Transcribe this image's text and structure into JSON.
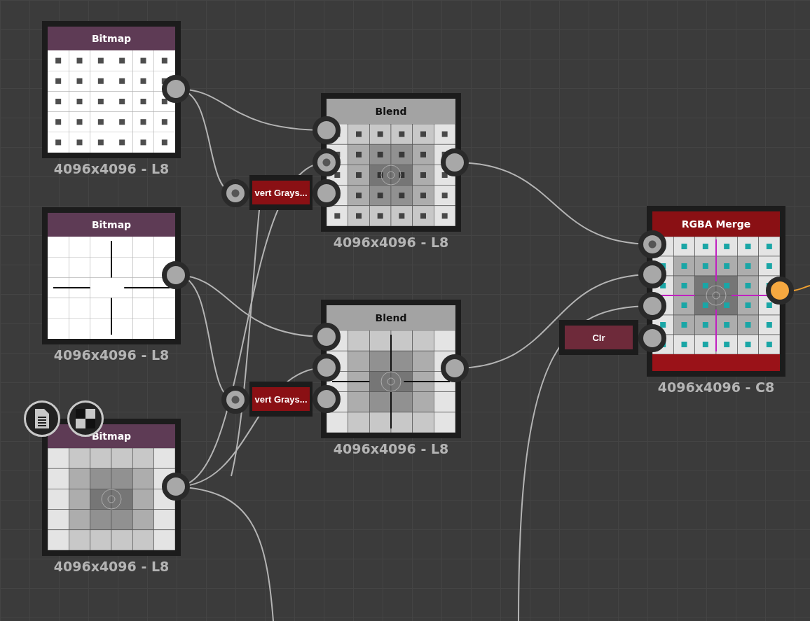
{
  "graph": {
    "nodes": [
      {
        "kind": "bitmap",
        "title": "Bitmap",
        "preview": {
          "kind": "numbered"
        },
        "resolution": "4096x4096 - L8",
        "output": {
          "highlighted": false
        }
      },
      {
        "kind": "bitmap",
        "title": "Bitmap",
        "preview": {
          "kind": "arrows"
        },
        "resolution": "4096x4096 - L8",
        "output": {
          "highlighted": false
        }
      },
      {
        "kind": "bitmap",
        "title": "Bitmap",
        "preview": {
          "kind": "gray"
        },
        "resolution": "4096x4096 - L8",
        "show_badges": true,
        "output": {
          "highlighted": false
        }
      },
      {
        "kind": "invert",
        "title": "vert Grays...",
        "inputs": [
          {
            "active": true
          }
        ]
      },
      {
        "kind": "invert",
        "title": "vert Grays...",
        "inputs": [
          {
            "active": true
          }
        ]
      },
      {
        "kind": "blend",
        "title": "Blend",
        "preview": {
          "kind": "numbered-gray"
        },
        "resolution": "4096x4096 - L8",
        "inputs": [
          {
            "active": false
          },
          {
            "active": true
          },
          {
            "active": false
          }
        ],
        "output": {
          "highlighted": false
        }
      },
      {
        "kind": "blend",
        "title": "Blend",
        "preview": {
          "kind": "arrows-gray"
        },
        "resolution": "4096x4096 - L8",
        "inputs": [
          {
            "active": false
          },
          {
            "active": false
          },
          {
            "active": false
          }
        ],
        "output": {
          "highlighted": false
        }
      },
      {
        "kind": "merge",
        "title": "RGBA Merge",
        "preview": {
          "kind": "color"
        },
        "resolution": "4096x4096 - C8",
        "inputs": [
          {
            "active": true
          },
          {
            "active": false
          },
          {
            "active": false
          },
          {
            "active": false
          }
        ],
        "output": {
          "highlighted": true
        }
      },
      {
        "kind": "color",
        "title": "Clr"
      }
    ]
  }
}
